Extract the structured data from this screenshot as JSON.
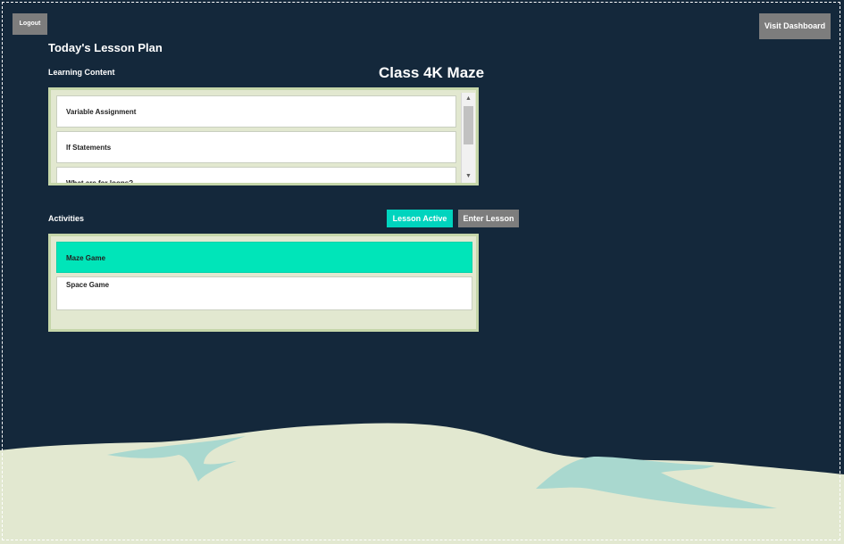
{
  "header": {
    "logout_label": "Logout",
    "visit_dashboard_label": "Visit Dashboard"
  },
  "page": {
    "title": "Today's Lesson Plan",
    "class_title": "Class 4K Maze"
  },
  "learning_content": {
    "label": "Learning Content",
    "items": [
      {
        "label": "Variable Assignment"
      },
      {
        "label": "If Statements"
      },
      {
        "label": "What are for loops?"
      }
    ]
  },
  "activities": {
    "label": "Activities",
    "lesson_active_label": "Lesson Active",
    "enter_lesson_label": "Enter Lesson",
    "items": [
      {
        "label": "Maze Game",
        "selected": true
      },
      {
        "label": "Space Game",
        "selected": false
      }
    ]
  },
  "colors": {
    "background": "#14283b",
    "accent": "#00e5b9",
    "panel": "#e2e8d0",
    "button_gray": "#7d7d7d",
    "ground": "#e2e8d0",
    "water": "#a9d8cf"
  },
  "icons": {
    "scroll_up": "triangle-up-icon",
    "scroll_down": "triangle-down-icon"
  }
}
